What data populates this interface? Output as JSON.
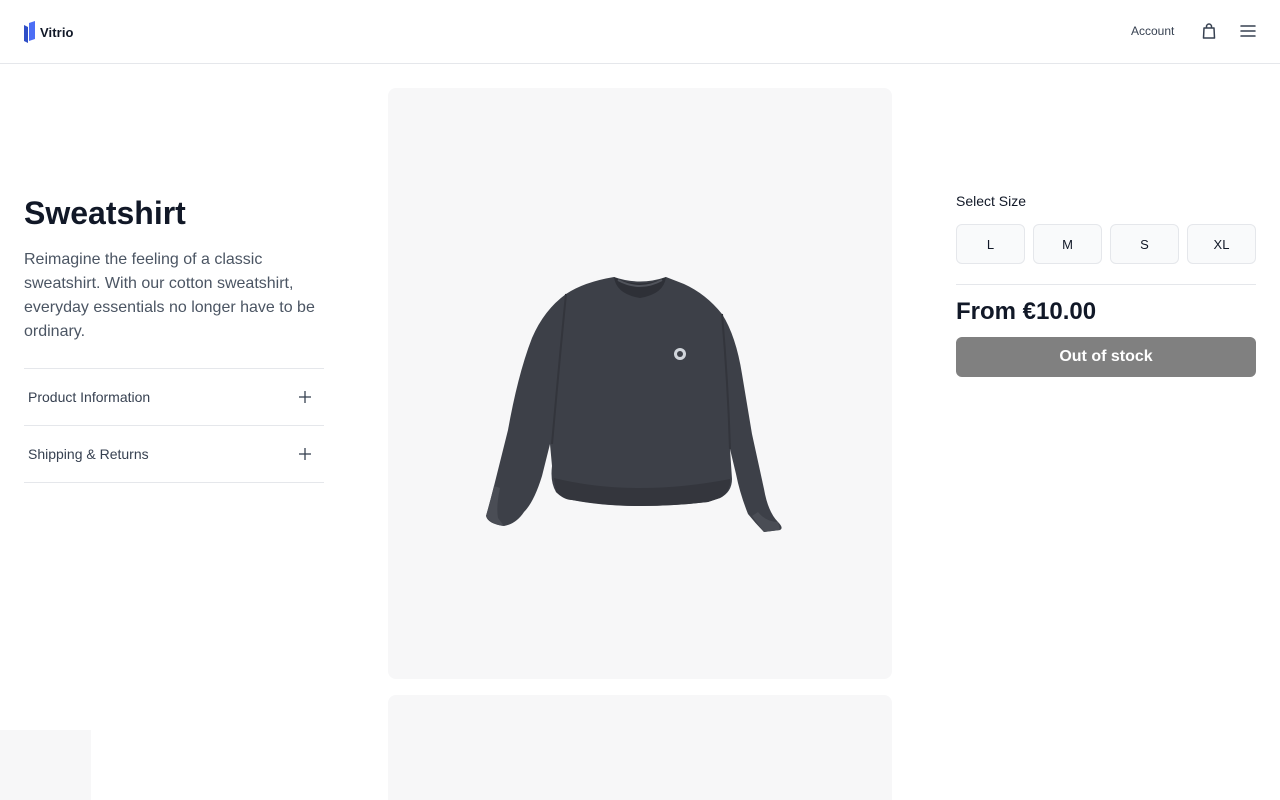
{
  "header": {
    "brand": "Vitrio",
    "account_label": "Account",
    "icons": {
      "logo": "brand-logo-icon",
      "bag": "shopping-bag-icon",
      "menu": "hamburger-menu-icon"
    },
    "brand_color": "#3b5bdb"
  },
  "product": {
    "title": "Sweatshirt",
    "description": "Reimagine the feeling of a classic sweatshirt. With our cotton sweatshirt, everyday essentials no longer have to be ordinary."
  },
  "accordion": {
    "items": [
      {
        "label": "Product Information",
        "icon": "plus-icon"
      },
      {
        "label": "Shipping & Returns",
        "icon": "plus-icon"
      }
    ]
  },
  "purchase": {
    "size_label": "Select Size",
    "sizes": [
      "L",
      "M",
      "S",
      "XL"
    ],
    "price": "From €10.00",
    "button_label": "Out of stock",
    "button_color": "#808080"
  }
}
